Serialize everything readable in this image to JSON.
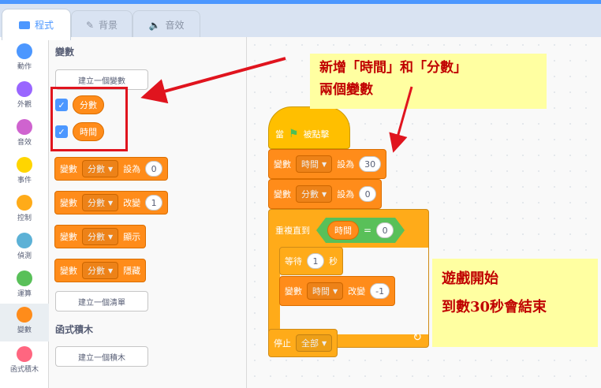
{
  "tabs": [
    {
      "label": "程式",
      "icon": "code-icon",
      "active": true
    },
    {
      "label": "背景",
      "icon": "paintbrush-icon",
      "active": false
    },
    {
      "label": "音效",
      "icon": "speaker-icon",
      "active": false
    }
  ],
  "categories": [
    {
      "label": "動作",
      "color": "#4c97ff"
    },
    {
      "label": "外觀",
      "color": "#9966ff"
    },
    {
      "label": "音效",
      "color": "#cf63cf"
    },
    {
      "label": "事件",
      "color": "#ffd500"
    },
    {
      "label": "控制",
      "color": "#ffab19"
    },
    {
      "label": "偵測",
      "color": "#5cb1d6"
    },
    {
      "label": "運算",
      "color": "#59c059"
    },
    {
      "label": "變數",
      "color": "#ff8c1a"
    },
    {
      "label": "函式積木",
      "color": "#ff6680"
    }
  ],
  "palette": {
    "variables_title": "變數",
    "make_variable": "建立一個變數",
    "var1": "分數",
    "var2": "時間",
    "set_block": {
      "prefix": "變數",
      "var": "分數",
      "action": "設為",
      "value": "0"
    },
    "change_block": {
      "prefix": "變數",
      "var": "分數",
      "action": "改變",
      "value": "1"
    },
    "show_block": {
      "prefix": "變數",
      "var": "分數",
      "action": "顯示"
    },
    "hide_block": {
      "prefix": "變數",
      "var": "分數",
      "action": "隱藏"
    },
    "make_list": "建立一個清單",
    "my_blocks_title": "函式積木",
    "make_block": "建立一個積木"
  },
  "script": {
    "hat": {
      "prefix": "當",
      "suffix": "被點擊"
    },
    "set_time": {
      "prefix": "變數",
      "var": "時間",
      "action": "設為",
      "value": "30"
    },
    "set_score": {
      "prefix": "變數",
      "var": "分數",
      "action": "設為",
      "value": "0"
    },
    "repeat_until": {
      "label": "重複直到",
      "var": "時間",
      "op": "=",
      "value": "0"
    },
    "wait": {
      "label": "等待",
      "value": "1",
      "unit": "秒"
    },
    "change_time": {
      "prefix": "變數",
      "var": "時間",
      "action": "改變",
      "value": "-1"
    },
    "stop": {
      "label": "停止",
      "option": "全部"
    }
  },
  "notes": {
    "top_line1": "新增「時間」和「分數」",
    "top_line2": "兩個變數",
    "bottom_line1": "遊戲開始",
    "bottom_line2": "到數30秒會結束"
  },
  "colors": {
    "annotation_red": "#e0141e",
    "variables": "#ff8c1a",
    "control": "#ffab19",
    "events": "#ffbf00",
    "operators": "#59c059"
  }
}
